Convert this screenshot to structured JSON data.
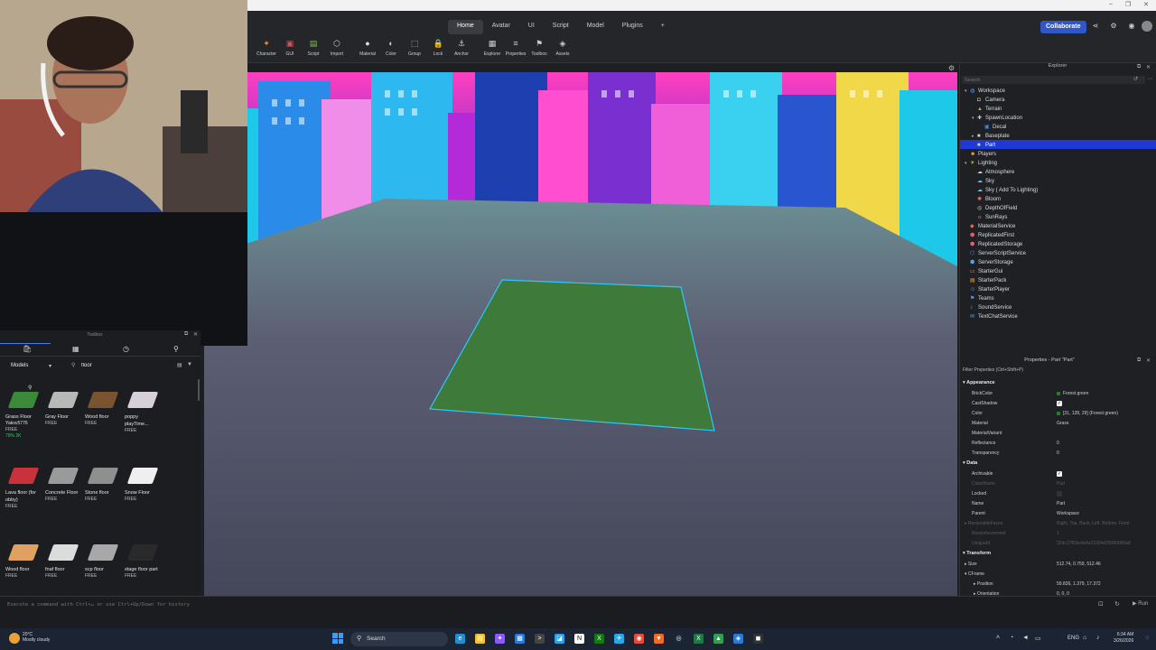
{
  "window_controls": [
    "–",
    "❐",
    "✕"
  ],
  "header": {
    "tabs": [
      {
        "label": "Home",
        "active": true
      },
      {
        "label": "Avatar"
      },
      {
        "label": "UI"
      },
      {
        "label": "Script"
      },
      {
        "label": "Model"
      },
      {
        "label": "Plugins"
      },
      {
        "label": "+"
      }
    ],
    "collaborate_label": "Collaborate",
    "tools": [
      "Character",
      "GUI",
      "Script",
      "Import",
      "Material",
      "Color",
      "Group",
      "Lock",
      "Anchor",
      "Explorer",
      "Properties",
      "Toolbox",
      "Assets"
    ]
  },
  "toolbox": {
    "title": "Toolbox",
    "category": "Models",
    "search_value": "floor",
    "assets": [
      {
        "name": "Grass Floor",
        "price": "FREE",
        "creator": "Yakov5776",
        "rating": "79% 2K",
        "color": "#3a8a3a"
      },
      {
        "name": "Gray Floor",
        "price": "FREE",
        "color": "#b8b8b8"
      },
      {
        "name": "Wood floor",
        "price": "FREE",
        "color": "#7a5430"
      },
      {
        "name": "poppy playTime...",
        "price": "FREE",
        "color": "#d8d0d8"
      },
      {
        "name": "Lava floor (for obby)",
        "price": "FREE",
        "color": "#c8323c"
      },
      {
        "name": "Concrete Floor",
        "price": "FREE",
        "color": "#9a9a9a"
      },
      {
        "name": "Stone floor",
        "price": "FREE",
        "color": "#8f8f8f"
      },
      {
        "name": "Snow Floor",
        "price": "FREE",
        "color": "#efefef"
      },
      {
        "name": "Wood floor",
        "price": "FREE",
        "color": "#e0a060"
      },
      {
        "name": "fnaf floor",
        "price": "FREE",
        "color": "#dcdcdc"
      },
      {
        "name": "scp floor",
        "price": "FREE",
        "color": "#a8a8a8"
      },
      {
        "name": "stage floor part",
        "price": "FREE",
        "color": "#2a2a2a"
      }
    ]
  },
  "explorer": {
    "title": "Explorer",
    "search_placeholder": "Search",
    "items": [
      {
        "label": "Workspace",
        "icon": "globe-icon",
        "color": "#4aa3ff",
        "depth": 0,
        "expanded": true
      },
      {
        "label": "Camera",
        "icon": "camera-icon",
        "color": "#cfcfcf",
        "depth": 1
      },
      {
        "label": "Terrain",
        "icon": "terrain-icon",
        "color": "#c8a050",
        "depth": 1
      },
      {
        "label": "SpawnLocation",
        "icon": "spawn-icon",
        "color": "#cfcfcf",
        "depth": 1,
        "expanded": true
      },
      {
        "label": "Decal",
        "icon": "decal-icon",
        "color": "#3f8ae0",
        "depth": 2
      },
      {
        "label": "Baseplate",
        "icon": "part-icon",
        "color": "#cfcfcf",
        "depth": 1,
        "collapsed": true
      },
      {
        "label": "Part",
        "icon": "part-icon",
        "color": "#cfcfcf",
        "depth": 1,
        "selected": true
      },
      {
        "label": "Players",
        "icon": "players-icon",
        "color": "#f0a040",
        "depth": 0
      },
      {
        "label": "Lighting",
        "icon": "lighting-icon",
        "color": "#f5d442",
        "depth": 0,
        "expanded": true
      },
      {
        "label": "Atmosphere",
        "icon": "atmosphere-icon",
        "color": "#cfcfcf",
        "depth": 1
      },
      {
        "label": "Sky",
        "icon": "sky-icon",
        "color": "#7fb3ff",
        "depth": 1
      },
      {
        "label": "Sky ( Add To Lighting)",
        "icon": "sky-icon",
        "color": "#7fb3ff",
        "depth": 1
      },
      {
        "label": "Bloom",
        "icon": "bloom-icon",
        "color": "#ff6a6a",
        "depth": 1
      },
      {
        "label": "DepthOfField",
        "icon": "dof-icon",
        "color": "#cfcfcf",
        "depth": 1
      },
      {
        "label": "SunRays",
        "icon": "sunrays-icon",
        "color": "#f5d442",
        "depth": 1
      },
      {
        "label": "MaterialService",
        "icon": "material-icon",
        "color": "#e06c5a",
        "depth": 0
      },
      {
        "label": "ReplicatedFirst",
        "icon": "replicated-icon",
        "color": "#e0607a",
        "depth": 0
      },
      {
        "label": "ReplicatedStorage",
        "icon": "storage-icon",
        "color": "#e0607a",
        "depth": 0
      },
      {
        "label": "ServerScriptService",
        "icon": "server-script-icon",
        "color": "#5aa0e0",
        "depth": 0
      },
      {
        "label": "ServerStorage",
        "icon": "storage-icon",
        "color": "#5aa0e0",
        "depth": 0
      },
      {
        "label": "StarterGui",
        "icon": "gui-icon",
        "color": "#e0a050",
        "depth": 0
      },
      {
        "label": "StarterPack",
        "icon": "pack-icon",
        "color": "#e0a050",
        "depth": 0
      },
      {
        "label": "StarterPlayer",
        "icon": "player-icon",
        "color": "#5aa0e0",
        "depth": 0
      },
      {
        "label": "Teams",
        "icon": "teams-icon",
        "color": "#5aa0e0",
        "depth": 0
      },
      {
        "label": "SoundService",
        "icon": "sound-icon",
        "color": "#5aa0e0",
        "depth": 0
      },
      {
        "label": "TextChatService",
        "icon": "chat-icon",
        "color": "#5aa0e0",
        "depth": 0
      }
    ]
  },
  "properties": {
    "title": "Properties - Part \"Part\"",
    "filter": "Filter Properties (Ctrl+Shift+P)",
    "rows": [
      {
        "type": "section",
        "label": "Appearance"
      },
      {
        "name": "BrickColor",
        "value": "Forest green",
        "swatch": "#2a7a25"
      },
      {
        "name": "CastShadow",
        "check": true
      },
      {
        "name": "Color",
        "value": "[31, 128, 29] (Forest green)",
        "swatch": "#1f801d"
      },
      {
        "name": "Material",
        "value": "Grass"
      },
      {
        "name": "MaterialVariant",
        "value": ""
      },
      {
        "name": "Reflectance",
        "value": "0"
      },
      {
        "name": "Transparency",
        "value": "0"
      },
      {
        "type": "section",
        "label": "Data"
      },
      {
        "name": "Archivable",
        "check": true
      },
      {
        "name": "ClassName",
        "value": "Part",
        "dim": true
      },
      {
        "name": "Locked",
        "value": ""
      },
      {
        "name": "Name",
        "value": "Part"
      },
      {
        "name": "Parent",
        "value": "Workspace"
      },
      {
        "name": "ResizeableFaces",
        "value": "Right, Top, Back, Left, Bottom, Front",
        "dim": true,
        "arrow": true
      },
      {
        "name": "ResizeIncrement",
        "value": "1",
        "dim": true
      },
      {
        "name": "UniqueId",
        "value": "32dc17f59eda4e21004d25080000a8",
        "dim": true
      },
      {
        "type": "section",
        "label": "Transform"
      },
      {
        "name": "Size",
        "value": "512.74, 0.759, 512.46",
        "arrow": true
      },
      {
        "name": "CFrame",
        "value": "",
        "expanded": true
      },
      {
        "name": "Position",
        "value": "59.826, 1.379, 17.372",
        "arrow": true,
        "indent": true
      },
      {
        "name": "Orientation",
        "value": "0, 0, 0",
        "arrow": true,
        "indent": true
      }
    ]
  },
  "command_bar": {
    "placeholder": "Execute a command with Ctrl+↵ or use Ctrl+Up/Down for history"
  },
  "taskbar": {
    "weather_temp": "20°C",
    "weather_desc": "Mostly cloudy",
    "search_label": "Search",
    "lang": "ENG",
    "time": "6:34 AM",
    "date": "3/26/2026"
  }
}
